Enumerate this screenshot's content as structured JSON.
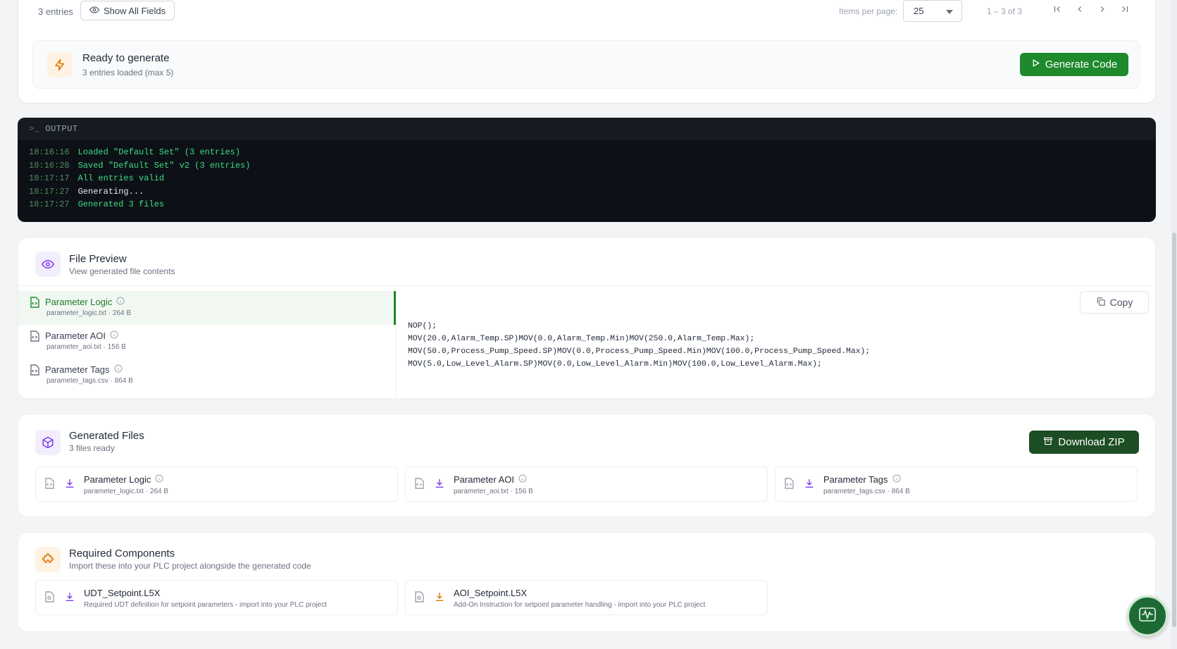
{
  "table_footer": {
    "entries_count": "3 entries",
    "show_all_fields_label": "Show All Fields",
    "items_per_page_label": "Items per page:",
    "items_per_page_value": "25",
    "range_text": "1 – 3 of 3"
  },
  "ready": {
    "title": "Ready to generate",
    "subtitle": "3 entries loaded (max 5)",
    "generate_label": "Generate Code"
  },
  "output": {
    "header": "OUTPUT",
    "lines": [
      {
        "time": "18:16:16",
        "msg": "Loaded \"Default Set\" (3 entries)",
        "kind": "success"
      },
      {
        "time": "18:16:28",
        "msg": "Saved \"Default Set\" v2 (3 entries)",
        "kind": "success"
      },
      {
        "time": "18:17:17",
        "msg": "All entries valid",
        "kind": "success"
      },
      {
        "time": "18:17:27",
        "msg": "Generating...",
        "kind": "info"
      },
      {
        "time": "18:17:27",
        "msg": "Generated 3 files",
        "kind": "success"
      }
    ]
  },
  "file_preview": {
    "title": "File Preview",
    "subtitle": "View generated file contents",
    "copy_label": "Copy",
    "files": [
      {
        "name": "Parameter Logic",
        "meta": "parameter_logic.txt · 264 B"
      },
      {
        "name": "Parameter AOI",
        "meta": "parameter_aoi.txt · 156 B"
      },
      {
        "name": "Parameter Tags",
        "meta": "parameter_tags.csv · 864 B"
      }
    ],
    "code_lines": [
      "NOP();",
      "MOV(20.0,Alarm_Temp.SP)MOV(0.0,Alarm_Temp.Min)MOV(250.0,Alarm_Temp.Max);",
      "MOV(50.0,Process_Pump_Speed.SP)MOV(0.0,Process_Pump_Speed.Min)MOV(100.0,Process_Pump_Speed.Max);",
      "MOV(5.0,Low_Level_Alarm.SP)MOV(0.0,Low_Level_Alarm.Min)MOV(100.0,Low_Level_Alarm.Max);"
    ]
  },
  "generated_files": {
    "title": "Generated Files",
    "subtitle": "3 files ready",
    "download_label": "Download ZIP",
    "files": [
      {
        "name": "Parameter Logic",
        "meta": "parameter_logic.txt · 264 B"
      },
      {
        "name": "Parameter AOI",
        "meta": "parameter_aoi.txt · 156 B"
      },
      {
        "name": "Parameter Tags",
        "meta": "parameter_tags.csv · 864 B"
      }
    ]
  },
  "required_components": {
    "title": "Required Components",
    "subtitle": "Import these into your PLC project alongside the generated code",
    "items": [
      {
        "name": "UDT_Setpoint.L5X",
        "desc": "Required UDT definition for setpoint parameters - import into your PLC project"
      },
      {
        "name": "AOI_Setpoint.L5X",
        "desc": "Add-On Instruction for setpoint parameter handling - import into your PLC project"
      }
    ]
  },
  "colors": {
    "primary_green": "#1e8a2c",
    "dark_green": "#1d4d24",
    "terminal_bg": "#0d1117",
    "accent_purple": "#7c3aed",
    "accent_orange": "#d97706"
  }
}
